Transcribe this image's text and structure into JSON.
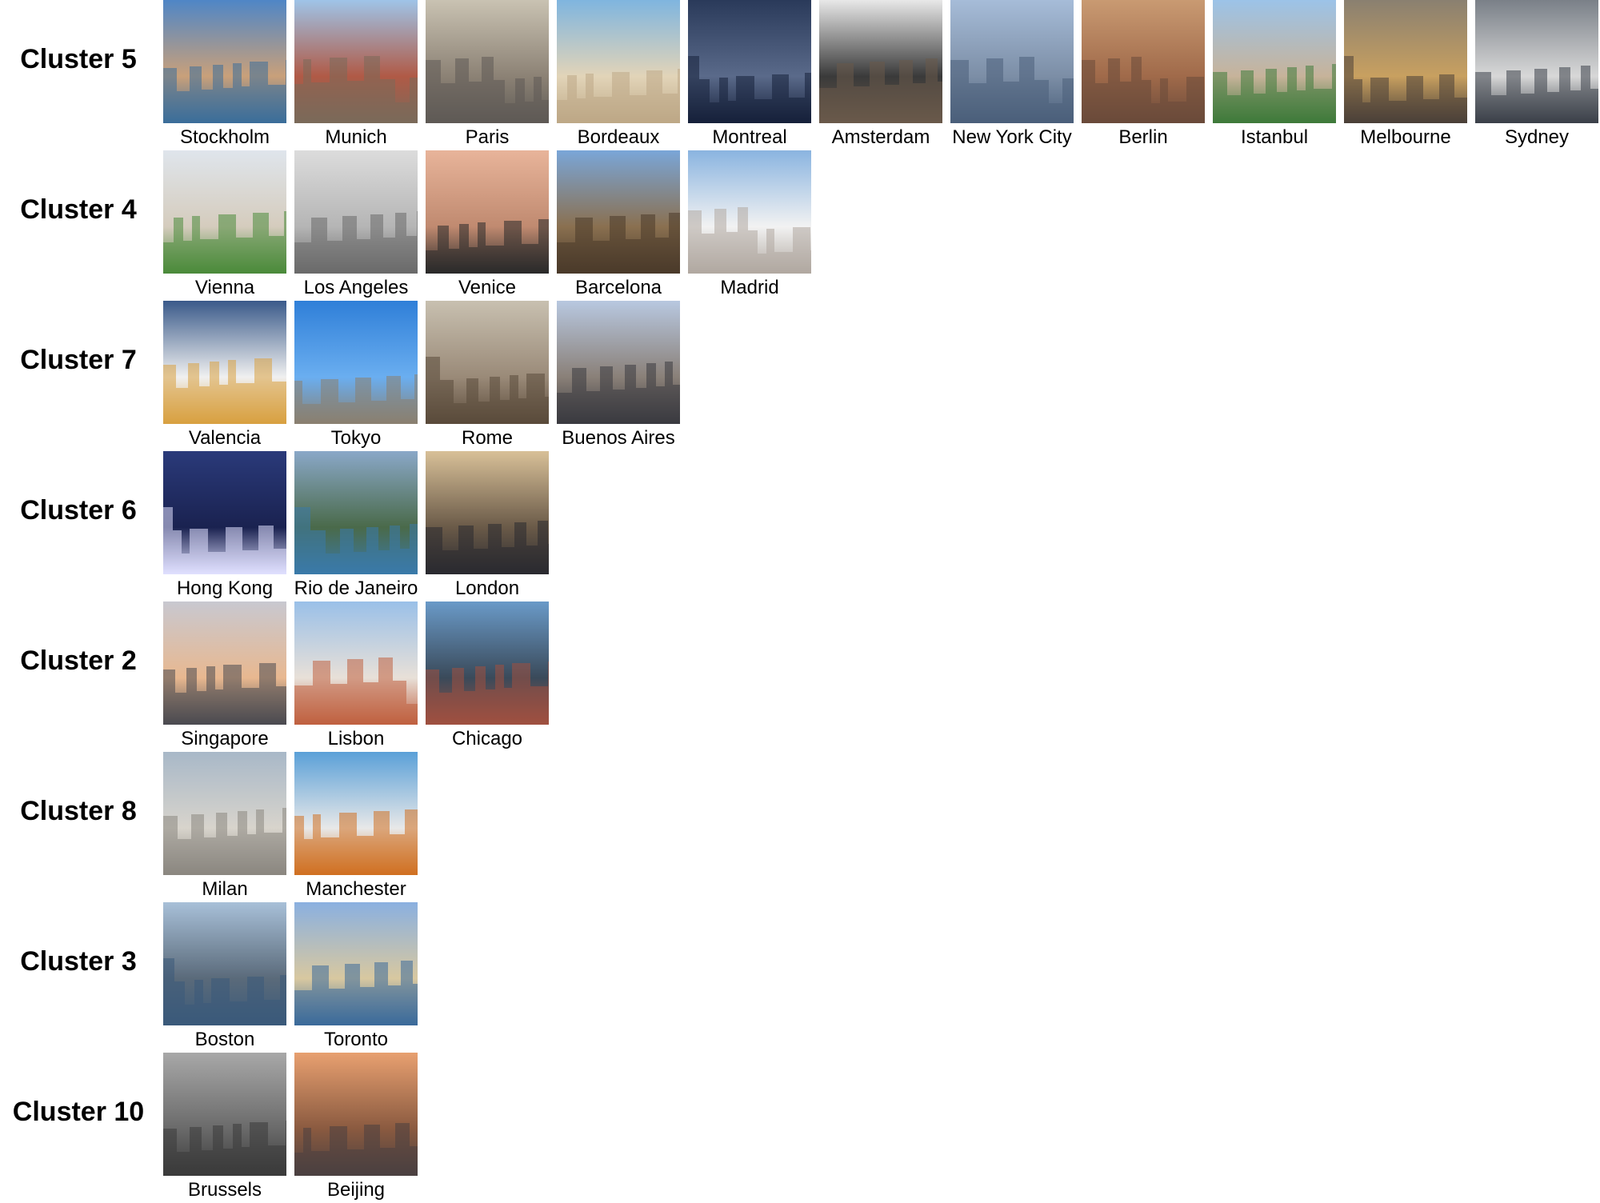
{
  "clusters": [
    {
      "label": "Cluster 5",
      "cities": [
        {
          "name": "Stockholm",
          "colors": [
            "#4f86c6",
            "#c9a07a",
            "#3a6e9a"
          ]
        },
        {
          "name": "Munich",
          "colors": [
            "#9fc4e8",
            "#b05a46",
            "#7a6a5a"
          ]
        },
        {
          "name": "Paris",
          "colors": [
            "#c9c2b2",
            "#8c8275",
            "#5e5a55"
          ]
        },
        {
          "name": "Bordeaux",
          "colors": [
            "#7fb5df",
            "#e2d4b8",
            "#bda886"
          ]
        },
        {
          "name": "Montreal",
          "colors": [
            "#2a3a5a",
            "#5a6a8a",
            "#16203a"
          ]
        },
        {
          "name": "Amsterdam",
          "colors": [
            "#e8e8e8",
            "#3a3a3a",
            "#6a5a4a"
          ]
        },
        {
          "name": "New York City",
          "colors": [
            "#a6bcd8",
            "#7c8ea6",
            "#4a5f7a"
          ]
        },
        {
          "name": "Berlin",
          "colors": [
            "#c99a72",
            "#a06a4a",
            "#6a4a3a"
          ]
        },
        {
          "name": "Istanbul",
          "colors": [
            "#9cc3e8",
            "#c7b39a",
            "#3e7a3a"
          ]
        },
        {
          "name": "Melbourne",
          "colors": [
            "#8a8070",
            "#c8a060",
            "#4a4038"
          ]
        },
        {
          "name": "Sydney",
          "colors": [
            "#7a8088",
            "#d8d8d8",
            "#3a4048"
          ]
        }
      ]
    },
    {
      "label": "Cluster 4",
      "cities": [
        {
          "name": "Vienna",
          "colors": [
            "#dfe5ec",
            "#d5ccbd",
            "#4a8a3a"
          ]
        },
        {
          "name": "Los Angeles",
          "colors": [
            "#dcdcdc",
            "#b5b5b5",
            "#6a6a6a"
          ]
        },
        {
          "name": "Venice",
          "colors": [
            "#e8b49a",
            "#c08a70",
            "#2a2a2a"
          ]
        },
        {
          "name": "Barcelona",
          "colors": [
            "#7aa6d8",
            "#8a7050",
            "#4a3a2a"
          ]
        },
        {
          "name": "Madrid",
          "colors": [
            "#8ab4e0",
            "#f2f2f2",
            "#b0a8a0"
          ]
        }
      ]
    },
    {
      "label": "Cluster 7",
      "cities": [
        {
          "name": "Valencia",
          "colors": [
            "#3a5a8a",
            "#f0f0f0",
            "#d8a040"
          ]
        },
        {
          "name": "Tokyo",
          "colors": [
            "#2f7fd8",
            "#6aaef0",
            "#8a8070"
          ]
        },
        {
          "name": "Rome",
          "colors": [
            "#c8c0b0",
            "#9a8a78",
            "#5a4a3a"
          ]
        },
        {
          "name": "Buenos Aires",
          "colors": [
            "#b8c8e0",
            "#8a8078",
            "#3a3a40"
          ]
        }
      ]
    },
    {
      "label": "Cluster 6",
      "cities": [
        {
          "name": "Hong Kong",
          "colors": [
            "#2a3a7a",
            "#1a2250",
            "#e0e0ff"
          ]
        },
        {
          "name": "Rio de Janeiro",
          "colors": [
            "#8aa8c8",
            "#4a6a4a",
            "#3a7aaa"
          ]
        },
        {
          "name": "London",
          "colors": [
            "#d8c098",
            "#6a5a48",
            "#2a2a30"
          ]
        }
      ]
    },
    {
      "label": "Cluster 2",
      "cities": [
        {
          "name": "Singapore",
          "colors": [
            "#c8c8d0",
            "#e8b890",
            "#4a4a50"
          ]
        },
        {
          "name": "Lisbon",
          "colors": [
            "#9ac0e8",
            "#e8e0d8",
            "#c06040"
          ]
        },
        {
          "name": "Chicago",
          "colors": [
            "#6a9ac8",
            "#3a4a5a",
            "#a05040"
          ]
        }
      ]
    },
    {
      "label": "Cluster 8",
      "cities": [
        {
          "name": "Milan",
          "colors": [
            "#a8b8c8",
            "#d8d4cc",
            "#8a8680"
          ]
        },
        {
          "name": "Manchester",
          "colors": [
            "#5aa0d8",
            "#e8e8e8",
            "#d07020"
          ]
        }
      ]
    },
    {
      "label": "Cluster 3",
      "cities": [
        {
          "name": "Boston",
          "colors": [
            "#a8c0d8",
            "#5a6a7a",
            "#3a5a7a"
          ]
        },
        {
          "name": "Toronto",
          "colors": [
            "#8ab0e0",
            "#d8c8a0",
            "#3a6a9a"
          ]
        }
      ]
    },
    {
      "label": "Cluster 10",
      "cities": [
        {
          "name": "Brussels",
          "colors": [
            "#a8a8a8",
            "#6a6a6a",
            "#3a3a3a"
          ]
        },
        {
          "name": "Beijing",
          "colors": [
            "#e8a070",
            "#8a5a40",
            "#4a4040"
          ]
        }
      ]
    }
  ]
}
